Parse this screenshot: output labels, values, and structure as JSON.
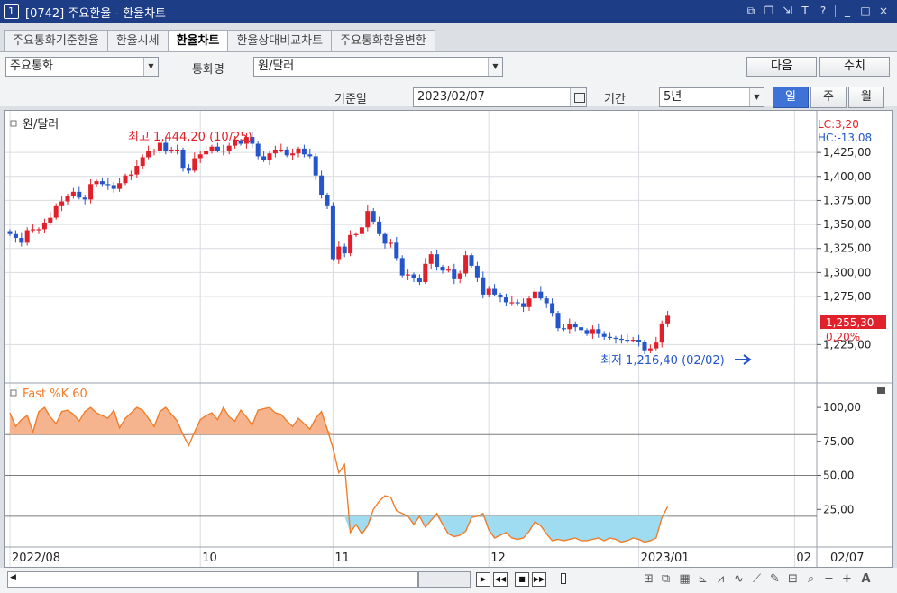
{
  "window": {
    "number": "1",
    "title": "[0742] 주요환율 - 환율차트",
    "controls": [
      "⧉",
      "❐",
      "⇲",
      "T",
      "?",
      "_",
      "□",
      "×"
    ]
  },
  "tabs": [
    {
      "label": "주요통화기준환율",
      "active": false
    },
    {
      "label": "환율시세",
      "active": false
    },
    {
      "label": "환율차트",
      "active": true
    },
    {
      "label": "환율상대비교차트",
      "active": false
    },
    {
      "label": "주요통화환율변환",
      "active": false
    }
  ],
  "toolbar": {
    "currency_group": "주요통화",
    "currency_name_label": "통화명",
    "currency_name": "원/달러",
    "next_label": "다음",
    "value_label": "수치",
    "base_date_label": "기준일",
    "base_date": "2023/02/07",
    "period_label": "기간",
    "period": "5년",
    "periods": [
      {
        "label": "일",
        "active": true
      },
      {
        "label": "주",
        "active": false
      },
      {
        "label": "월",
        "active": false
      }
    ]
  },
  "chart_data": [
    {
      "type": "candlestick",
      "title": "원/달러",
      "yticks": [
        "1,425,00",
        "1,400,00",
        "1,375,00",
        "1,350,00",
        "1,325,00",
        "1,300,00",
        "1,275,00",
        "1,225,00"
      ],
      "yrange": [
        1205,
        1448
      ],
      "lc_label": "LC:3,20",
      "hc_label": "HC:-13,08",
      "current_price": "1,255,30",
      "current_change": "0,20%",
      "max_annotation": "최고 1,444,20 (10/25)",
      "min_annotation": "최저 1,216,40 (02/02)",
      "closes": [
        1340,
        1336,
        1331,
        1344,
        1345,
        1345,
        1352,
        1357,
        1369,
        1374,
        1380,
        1384,
        1378,
        1376,
        1392,
        1395,
        1392,
        1391,
        1387,
        1393,
        1401,
        1402,
        1411,
        1420,
        1427,
        1427,
        1435,
        1426,
        1428,
        1428,
        1409,
        1406,
        1419,
        1423,
        1427,
        1431,
        1427,
        1427,
        1432,
        1437,
        1434,
        1441,
        1434,
        1421,
        1417,
        1424,
        1428,
        1428,
        1422,
        1424,
        1429,
        1423,
        1421,
        1401,
        1381,
        1369,
        1314,
        1327,
        1320,
        1339,
        1340,
        1347,
        1364,
        1353,
        1340,
        1330,
        1331,
        1315,
        1297,
        1298,
        1294,
        1290,
        1309,
        1319,
        1306,
        1302,
        1303,
        1293,
        1299,
        1318,
        1307,
        1295,
        1277,
        1283,
        1277,
        1274,
        1269,
        1269,
        1268,
        1264,
        1273,
        1280,
        1273,
        1268,
        1258,
        1242,
        1241,
        1246,
        1243,
        1240,
        1236,
        1241,
        1236,
        1233,
        1232,
        1231,
        1230,
        1229,
        1230,
        1228,
        1219,
        1221,
        1227,
        1247,
        1255
      ]
    },
    {
      "type": "line",
      "title": "Fast %K 60",
      "yticks": [
        "100,00",
        "75,00",
        "50,00",
        "25,00"
      ],
      "yrange": [
        0,
        110
      ],
      "reference_lines": [
        80,
        50,
        20
      ],
      "values": [
        96,
        86,
        91,
        94,
        82,
        97,
        100,
        93,
        88,
        97,
        98,
        95,
        90,
        97,
        100,
        96,
        94,
        92,
        98,
        85,
        92,
        96,
        100,
        98,
        92,
        86,
        97,
        100,
        95,
        90,
        80,
        72,
        82,
        91,
        94,
        96,
        91,
        100,
        93,
        90,
        98,
        93,
        87,
        98,
        99,
        100,
        96,
        95,
        90,
        86,
        92,
        88,
        84,
        92,
        97,
        84,
        70,
        52,
        58,
        8,
        14,
        7,
        13,
        25,
        31,
        35,
        34,
        24,
        22,
        20,
        14,
        20,
        12,
        17,
        22,
        14,
        7,
        5,
        6,
        9,
        19,
        20,
        22,
        10,
        4,
        6,
        8,
        4,
        3,
        4,
        9,
        16,
        13,
        7,
        2,
        3,
        2,
        3,
        4,
        2,
        2,
        3,
        4,
        2,
        4,
        3,
        1,
        2,
        4,
        3,
        1,
        2,
        4,
        19,
        27
      ],
      "fill_threshold": 20
    }
  ],
  "x_labels": [
    {
      "label": "2022/08",
      "index": 0
    },
    {
      "label": "10",
      "index": 33
    },
    {
      "label": "11",
      "index": 56
    },
    {
      "label": "12",
      "index": 83
    },
    {
      "label": "2023/01",
      "index": 109
    },
    {
      "label": "02",
      "index": 136
    }
  ],
  "x_date_box": "02/07",
  "colors": {
    "up": "#e0212b",
    "down": "#2455c9",
    "fastk_line": "#f07d2b",
    "fastk_fill_high": "#f5b48e",
    "fastk_fill_low": "#9fdcf2",
    "grid": "#d9dce1",
    "title_bar": "#1d3d86"
  }
}
